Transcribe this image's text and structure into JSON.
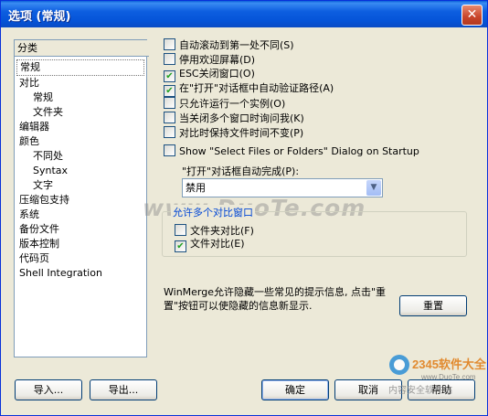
{
  "window": {
    "title": "选项 (常规)",
    "close_label": "✕"
  },
  "tree": {
    "header": "分类",
    "items": [
      {
        "label": "常规",
        "sub": false,
        "selected": true
      },
      {
        "label": "对比",
        "sub": false
      },
      {
        "label": "常规",
        "sub": true
      },
      {
        "label": "文件夹",
        "sub": true
      },
      {
        "label": "编辑器",
        "sub": false
      },
      {
        "label": "颜色",
        "sub": false
      },
      {
        "label": "不同处",
        "sub": true
      },
      {
        "label": "Syntax",
        "sub": true
      },
      {
        "label": "文字",
        "sub": true
      },
      {
        "label": "压缩包支持",
        "sub": false
      },
      {
        "label": "系统",
        "sub": false
      },
      {
        "label": "备份文件",
        "sub": false
      },
      {
        "label": "版本控制",
        "sub": false
      },
      {
        "label": "代码页",
        "sub": false
      },
      {
        "label": "Shell Integration",
        "sub": false
      }
    ]
  },
  "options": [
    {
      "label": "自动滚动到第一处不同(S)",
      "checked": false
    },
    {
      "label": "停用欢迎屏幕(D)",
      "checked": false
    },
    {
      "label": "ESC关闭窗口(O)",
      "checked": true
    },
    {
      "label": "在\"打开\"对话框中自动验证路径(A)",
      "checked": true
    },
    {
      "label": "只允许运行一个实例(O)",
      "checked": false
    },
    {
      "label": "当关闭多个窗口时询问我(K)",
      "checked": false
    },
    {
      "label": "对比时保持文件时间不变(P)",
      "checked": false
    },
    {
      "label": "Show \"Select Files or Folders\" Dialog on Startup",
      "checked": false
    }
  ],
  "autocomplete": {
    "label": "\"打开\"对话框自动完成(P):",
    "value": "禁用"
  },
  "group": {
    "title": "允许多个对比窗口",
    "items": [
      {
        "label": "文件夹对比(F)",
        "checked": false
      },
      {
        "label": "文件对比(E)",
        "checked": true
      }
    ]
  },
  "info_text": "WinMerge允许隐藏一些常见的提示信息, 点击\"重置\"按钮可以使隐藏的信息新显示.",
  "buttons": {
    "reset": "重置",
    "import": "导入...",
    "export": "导出...",
    "ok": "确定",
    "cancel": "取消",
    "help": "帮助"
  },
  "watermarks": {
    "main": "www.DuoTe.com",
    "corner_brand": "2345软件大全",
    "corner_url": "www.DuoTe.com",
    "corner_text": "内容安全软件站"
  }
}
